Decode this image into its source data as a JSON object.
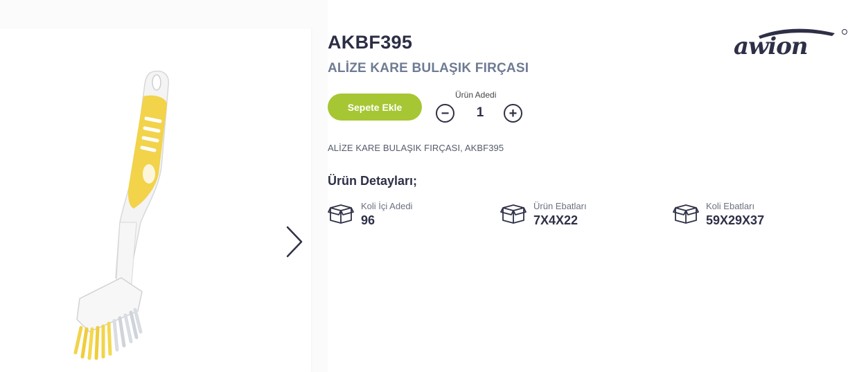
{
  "product": {
    "sku": "AKBF395",
    "name": "ALİZE KARE BULAŞIK FIRÇASI",
    "description": "ALİZE KARE BULAŞIK FIRÇASI, AKBF395"
  },
  "cart": {
    "add_label": "Sepete Ekle",
    "quantity_label": "Ürün Adedi",
    "quantity_value": "1",
    "minus_symbol": "−",
    "plus_symbol": "+"
  },
  "details": {
    "title": "Ürün Detayları;",
    "items": [
      {
        "label": "Koli İçi Adedi",
        "value": "96",
        "icon": "box-icon"
      },
      {
        "label": "Ürün Ebatları",
        "value": "7X4X22",
        "icon": "box-icon"
      },
      {
        "label": "Koli Ebatları",
        "value": "59X29X37",
        "icon": "box-icon"
      }
    ]
  },
  "brand": {
    "logo_text": "awion"
  },
  "colors": {
    "accent_green": "#a6c633",
    "text_dark": "#2e3047",
    "name_grey": "#6e7b93",
    "brush_yellow": "#f2d34a"
  },
  "icons": {
    "next": "chevron-right-icon"
  }
}
